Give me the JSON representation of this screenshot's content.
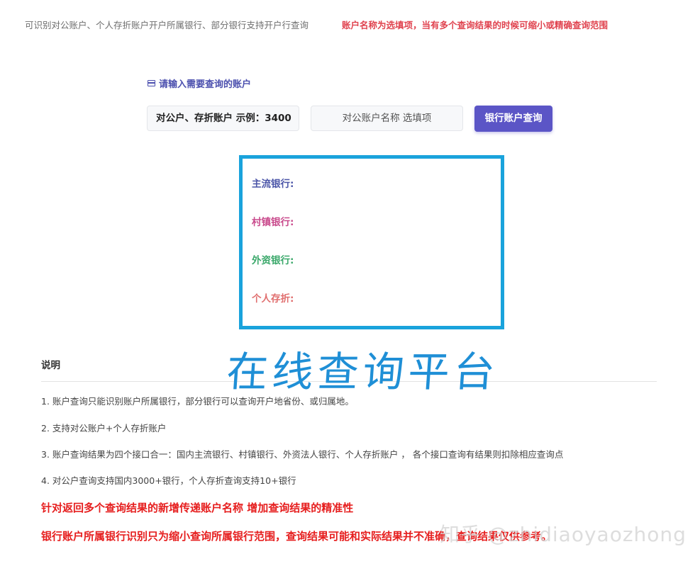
{
  "header": {
    "note": "可识别对公账户、个人存折账户开户所属银行、部分银行支持开户行查询",
    "warning": "账户名称为选填项，当有多个查询结果的时候可缩小或精确查询范围"
  },
  "query_form": {
    "section_title": "请输入需要查询的账户",
    "account_input_value": "对公户、存折账户 示例：3400",
    "name_input_placeholder": "对公账户名称 选填项",
    "submit_label": "银行账户查询"
  },
  "results": {
    "mainstream": "主流银行:",
    "village": "村镇银行:",
    "foreign": "外资银行:",
    "personal": "个人存折:"
  },
  "notes": {
    "title": "说明",
    "items": [
      "1. 账户查询只能识别账户所属银行，部分银行可以查询开户地省份、或归属地。",
      "2. 支持对公账户+个人存折账户",
      "3. 账户查询结果为四个接口合一：国内主流银行、村镇银行、外资法人银行、个人存折账户 ， 各个接口查询有结果则扣除相应查询点",
      "4. 对公户查询支持国内3000+银行，个人存折查询支持10+银行"
    ],
    "highlights": [
      "针对返回多个查询结果的新增传递账户名称 增加查询结果的精准性",
      "银行账户所属银行识别只为缩小查询所属银行范围，查询结果可能和实际结果并不准确，查询结果仅供参考。"
    ]
  },
  "overlay_title": "在线查询平台",
  "site_watermark": "知乎 @zhidiaoyaozhong",
  "colors": {
    "accent": "#5b55c6",
    "box_border": "#1aa3dc",
    "warning_red": "#e61e1e"
  }
}
